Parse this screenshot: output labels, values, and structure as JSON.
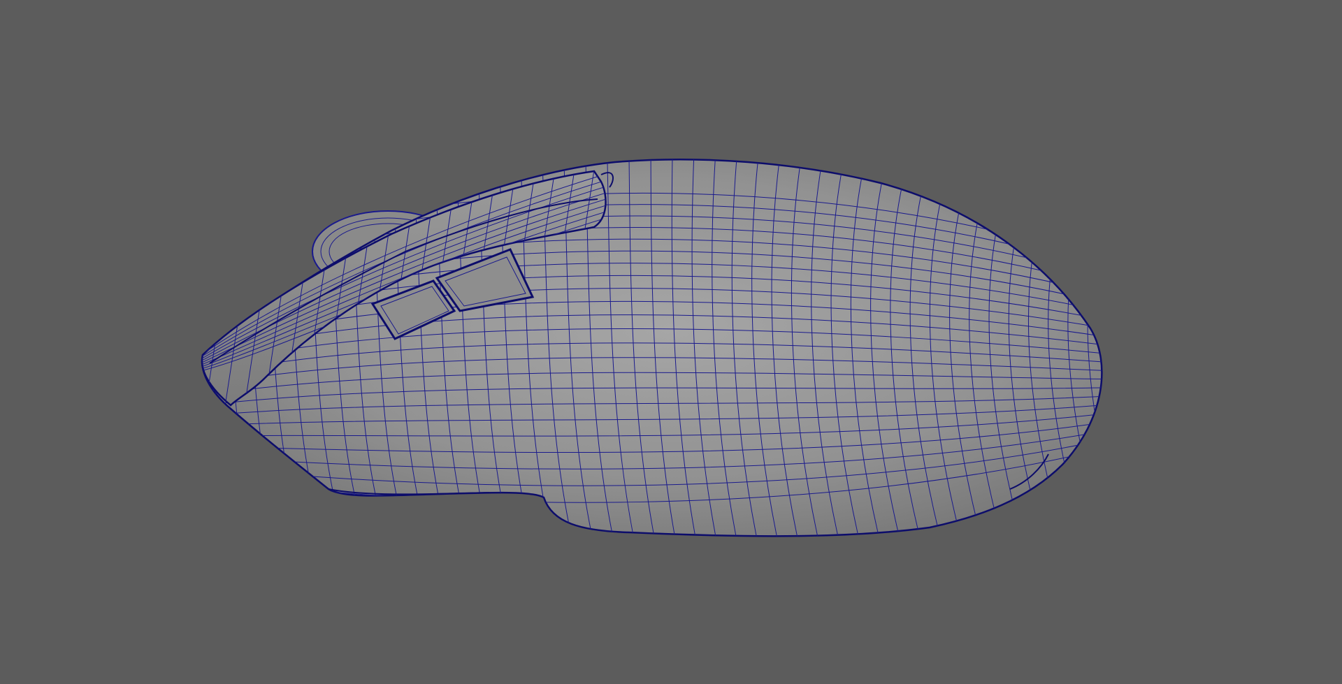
{
  "viewport": {
    "background_color": "#5c5c5c",
    "view_mode": "shaded-with-wireframe"
  },
  "model": {
    "object": "computer-mouse",
    "shading_color": "#8f8f8f",
    "highlight_color": "#a4a4a4",
    "shadow_color": "#767676",
    "wire_color": "#1a1a8c",
    "wire_edge_color": "#0d0d6b",
    "parts": [
      "body-shell",
      "top-shell",
      "thumb-rest-lip",
      "scroll-wheel",
      "side-button-back",
      "side-button-forward"
    ]
  }
}
